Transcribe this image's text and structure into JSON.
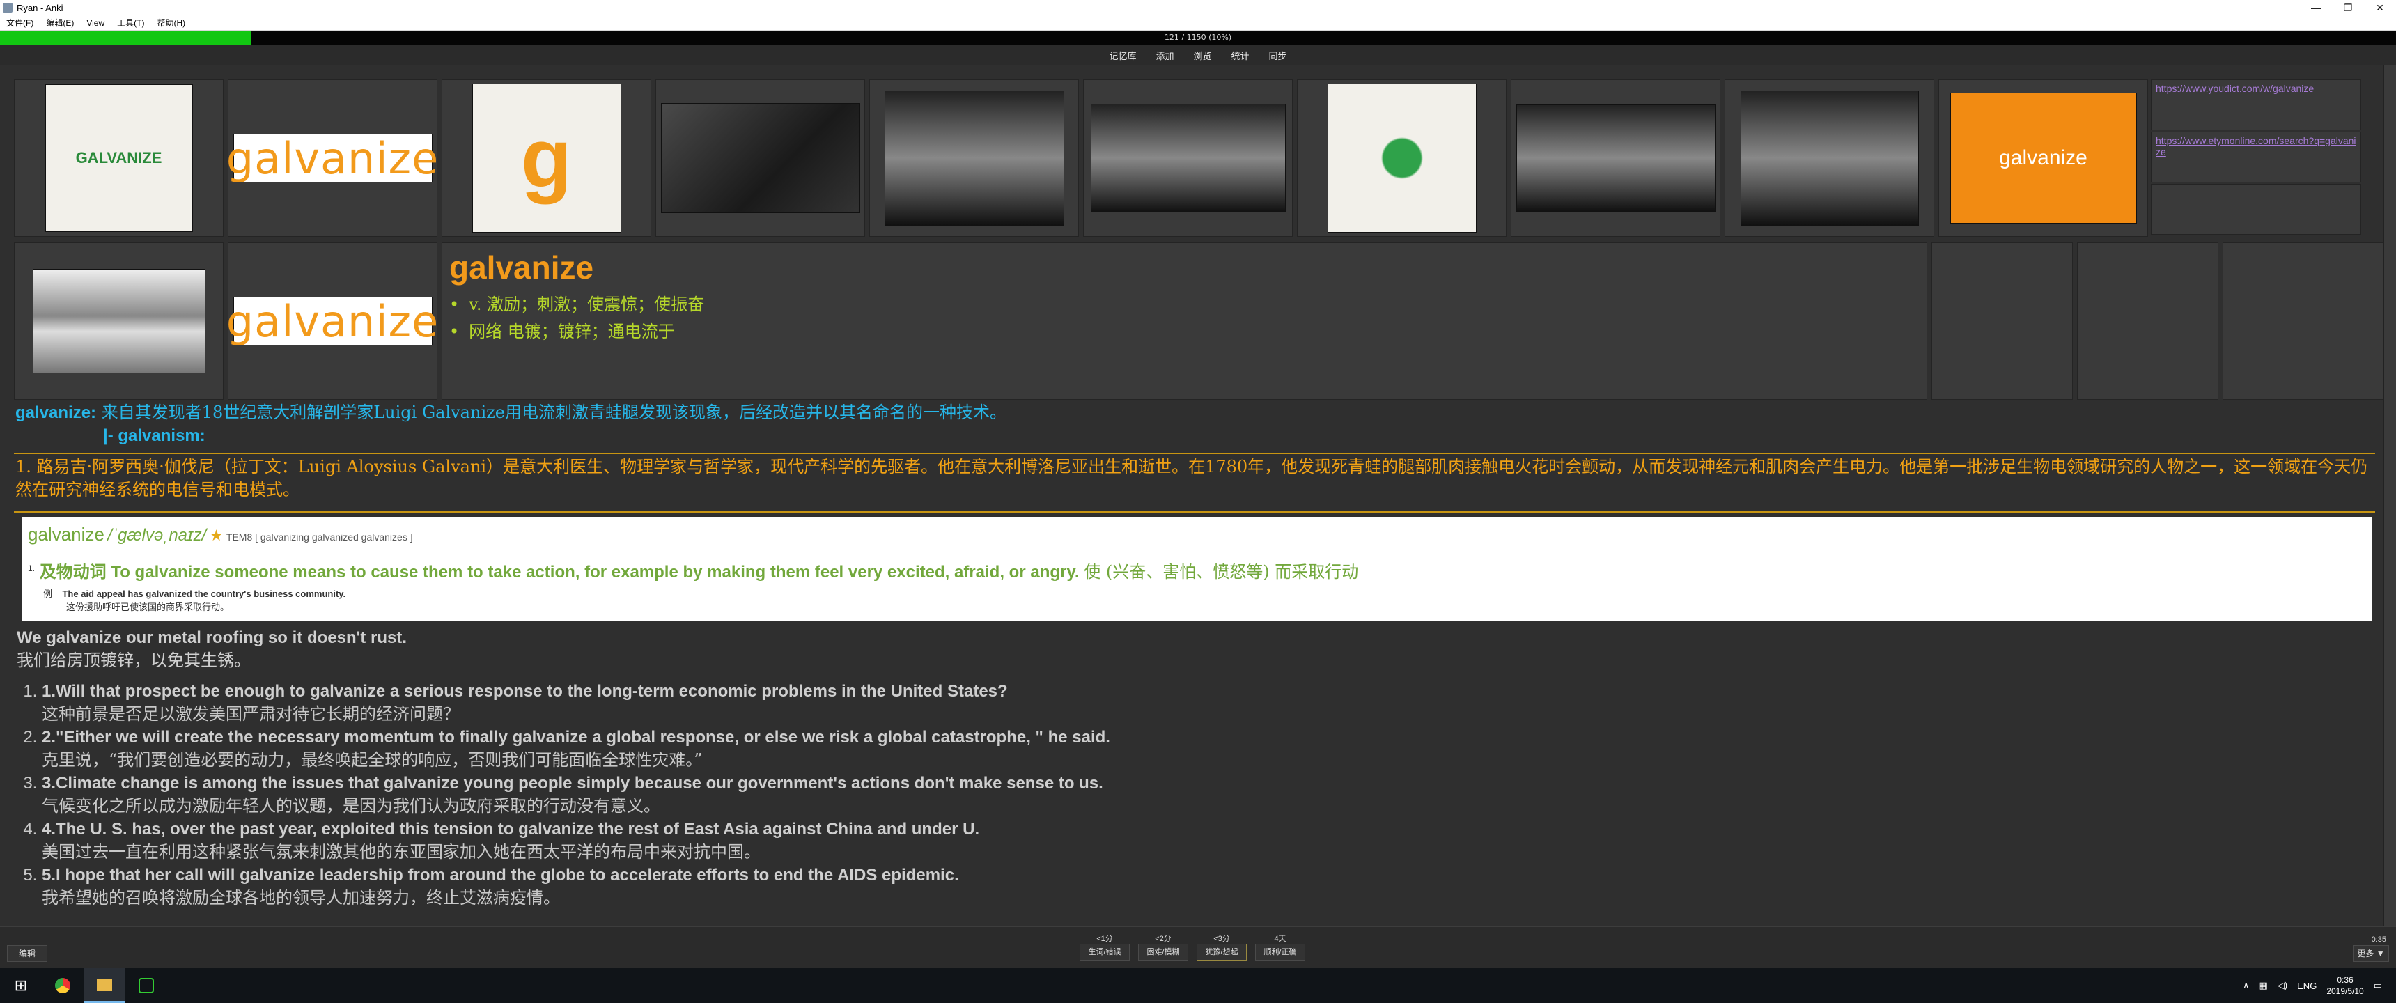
{
  "window": {
    "title": "Ryan - Anki",
    "minimize": "—",
    "restore": "❐",
    "close": "✕"
  },
  "menu": [
    "文件(F)",
    "编辑(E)",
    "View",
    "工具(T)",
    "帮助(H)"
  ],
  "progress": {
    "text": "121 / 1150 (10%)",
    "fraction": 0.105,
    "color": "#12c712"
  },
  "toolbar": [
    "记忆库",
    "添加",
    "浏览",
    "统计",
    "同步"
  ],
  "images": [
    {
      "name": "anvil-logo-image",
      "style": "white",
      "text": "GALVANIZE"
    },
    {
      "name": "galvanize-wordmark-image",
      "style": "wordmark",
      "text": "galvanize"
    },
    {
      "name": "galvanize-g-logo-image",
      "style": "white",
      "text": "g"
    },
    {
      "name": "group-photo-image",
      "style": "dark",
      "text": ""
    },
    {
      "name": "clown-face-image-1",
      "style": "bw",
      "text": ""
    },
    {
      "name": "clown-face-image-2",
      "style": "bw",
      "text": ""
    },
    {
      "name": "hand-logo-image",
      "style": "white",
      "text": ""
    },
    {
      "name": "clown-face-image-3",
      "style": "bw",
      "text": ""
    },
    {
      "name": "clown-portrait-image",
      "style": "bw",
      "text": ""
    },
    {
      "name": "galvanize-orange-logo-image",
      "style": "orange",
      "text": "galvanize"
    }
  ],
  "links": [
    "https://www.youdict.com/w/galvanize",
    "https://www.etymonline.com/search?q=galvanize",
    ""
  ],
  "row2": {
    "image1": "galvanized-steel-coils-image",
    "wordmark": "galvanize"
  },
  "word": {
    "title": "galvanize",
    "defs": [
      "v. 激励；刺激；使震惊；使振奋",
      "网络 电镀；镀锌；通电流于"
    ]
  },
  "etymology": {
    "label": "galvanize:",
    "text": "来自其发现者18世纪意大利解剖学家Luigi Galvanize用电流刺激青蛙腿发现该现象，后经改造并以其名命名的一种技术。",
    "sub": "|- galvanism:"
  },
  "bio": "1. 路易吉·阿罗西奥·伽伐尼（拉丁文：Luigi Aloysius Galvani）是意大利医生、物理学家与哲学家，现代产科学的先驱者。他在意大利博洛尼亚出生和逝世。在1780年，他发现死青蛙的腿部肌肉接触电火花时会颤动，从而发现神经元和肌肉会产生电力。他是第一批涉足生物电领域研究的人物之一，这一领域在今天仍然在研究神经系统的电信号和电模式。",
  "dict": {
    "headword": "galvanize",
    "phonetic": "/ˈɡælvəˌnaɪz/",
    "star": "★",
    "tags": "TEM8  [ galvanizing galvanized galvanizes ]",
    "sense_num": "1.",
    "sense_en": "及物动词 To galvanize someone means to cause them to take action, for example by making them feel very excited, afraid, or angry.",
    "sense_cn": "使 (兴奋、害怕、愤怒等) 而采取行动",
    "ex_label": "例",
    "ex_en": "The aid appeal has galvanized the country's business community.",
    "ex_cn": "这份援助呼吁已使该国的商界采取行动。"
  },
  "examples": {
    "lead_en": "We galvanize our metal roofing so it doesn't rust.",
    "lead_cn": "我们给房顶镀锌，以免其生锈。",
    "items": [
      {
        "en": "1.Will that prospect be enough to galvanize a serious response to the long-term economic problems in the United States?",
        "cn": "这种前景是否足以激发美国严肃对待它长期的经济问题？"
      },
      {
        "en": "2.\"Either we will create the necessary momentum to finally galvanize a global response, or else we risk a global catastrophe, \" he said.",
        "cn": "克里说，“我们要创造必要的动力，最终唤起全球的响应，否则我们可能面临全球性灾难。”"
      },
      {
        "en": "3.Climate change is among the issues that galvanize young people simply because our government's actions don't make sense to us.",
        "cn": "气候变化之所以成为激励年轻人的议题，是因为我们认为政府采取的行动没有意义。"
      },
      {
        "en": "4.The U. S. has, over the past year, exploited this tension to galvanize the rest of East Asia against China and under U.",
        "cn": "美国过去一直在利用这种紧张气氛来刺激其他的东亚国家加入她在西太平洋的布局中来对抗中国。"
      },
      {
        "en": "5.I hope that her call will galvanize leadership from around the globe to accelerate efforts to end the AIDS epidemic.",
        "cn": "我希望她的召唤将激励全球各地的领导人加速努力，终止艾滋病疫情。"
      }
    ]
  },
  "answer": {
    "edit": "编辑",
    "more": "更多 ▼",
    "timer": "0:35",
    "buttons": [
      {
        "interval": "<1分",
        "label": "生词/错误"
      },
      {
        "interval": "<2分",
        "label": "困难/模糊"
      },
      {
        "interval": "<3分",
        "label": "犹豫/想起"
      },
      {
        "interval": "4天",
        "label": "顺利/正确"
      }
    ]
  },
  "taskbar": {
    "lang": "ENG",
    "time": "0:36",
    "date": "2019/5/10"
  }
}
